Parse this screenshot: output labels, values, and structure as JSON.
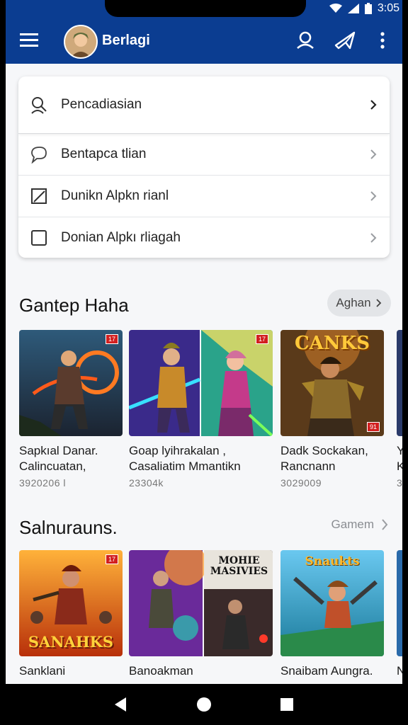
{
  "status": {
    "time": "3:05"
  },
  "appbar": {
    "title": "Berlagi",
    "icons": [
      "menu-icon",
      "user-icon",
      "airplane-icon",
      "more-vert-icon"
    ]
  },
  "menu": {
    "items": [
      {
        "label": "Pencadiasian",
        "icon": "search-icon"
      },
      {
        "label": "Bentapca tlian",
        "icon": "chat-icon"
      },
      {
        "label": "Dunikn Alpkn rianl",
        "icon": "edit-icon"
      },
      {
        "label": "Donian Alpkı rliagah",
        "icon": "checkbox-icon"
      }
    ]
  },
  "section1": {
    "title": "Gantep Haha",
    "action": "Aghan",
    "games": [
      {
        "name": "Sapkıal Danar.\nCalincuatan,",
        "count": "3920206 l",
        "badge": "17"
      },
      {
        "name": "Goap lyihrakalan ,\nCasaliatim Mmantikn",
        "count": "23304k",
        "badge": "17"
      },
      {
        "name": "Dadk Sockakan,\nRancnann",
        "count": "3029009",
        "badge": "91",
        "art": "CANKS"
      },
      {
        "name": "Y\nK",
        "count": "3"
      }
    ]
  },
  "section2": {
    "title": "Salnurauns.",
    "action": "Gamem",
    "games": [
      {
        "name": "Sanklani",
        "badge": "17",
        "art": "SANAHKS"
      },
      {
        "name": "Banoakman",
        "badge": ""
      },
      {
        "name": "Snaibam Aungra.",
        "badge": "",
        "art": "Snaukts"
      },
      {
        "name": "N"
      }
    ],
    "overlay_art": "MOHIE MASIVIES"
  },
  "colors": {
    "primary": "#0b3d91",
    "badge": "#d21f1f"
  }
}
